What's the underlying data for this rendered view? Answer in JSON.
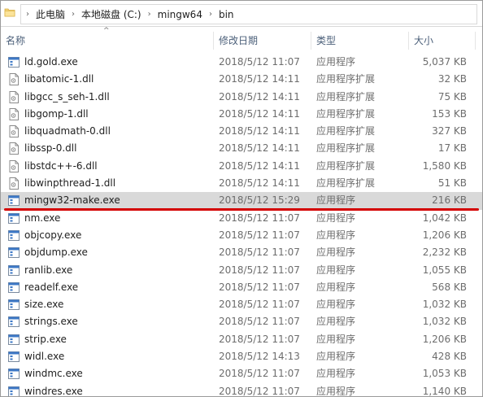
{
  "breadcrumb": {
    "items": [
      "此电脑",
      "本地磁盘 (C:)",
      "mingw64",
      "bin"
    ],
    "separator": "›"
  },
  "columns": {
    "name": "名称",
    "date": "修改日期",
    "type": "类型",
    "size": "大小"
  },
  "files": [
    {
      "name": "ld.gold.exe",
      "date": "2018/5/12 11:07",
      "type": "应用程序",
      "size": "5,037 KB",
      "icon": "exe-icon"
    },
    {
      "name": "libatomic-1.dll",
      "date": "2018/5/12 14:11",
      "type": "应用程序扩展",
      "size": "32 KB",
      "icon": "dll-icon"
    },
    {
      "name": "libgcc_s_seh-1.dll",
      "date": "2018/5/12 14:11",
      "type": "应用程序扩展",
      "size": "75 KB",
      "icon": "dll-icon"
    },
    {
      "name": "libgomp-1.dll",
      "date": "2018/5/12 14:11",
      "type": "应用程序扩展",
      "size": "153 KB",
      "icon": "dll-icon"
    },
    {
      "name": "libquadmath-0.dll",
      "date": "2018/5/12 14:11",
      "type": "应用程序扩展",
      "size": "327 KB",
      "icon": "dll-icon"
    },
    {
      "name": "libssp-0.dll",
      "date": "2018/5/12 14:11",
      "type": "应用程序扩展",
      "size": "17 KB",
      "icon": "dll-icon"
    },
    {
      "name": "libstdc++-6.dll",
      "date": "2018/5/12 14:11",
      "type": "应用程序扩展",
      "size": "1,580 KB",
      "icon": "dll-icon"
    },
    {
      "name": "libwinpthread-1.dll",
      "date": "2018/5/12 14:11",
      "type": "应用程序扩展",
      "size": "51 KB",
      "icon": "dll-icon"
    },
    {
      "name": "mingw32-make.exe",
      "date": "2018/5/12 15:29",
      "type": "应用程序",
      "size": "216 KB",
      "icon": "exe-icon",
      "selected": true
    },
    {
      "name": "nm.exe",
      "date": "2018/5/12 11:07",
      "type": "应用程序",
      "size": "1,042 KB",
      "icon": "exe-icon"
    },
    {
      "name": "objcopy.exe",
      "date": "2018/5/12 11:07",
      "type": "应用程序",
      "size": "1,206 KB",
      "icon": "exe-icon"
    },
    {
      "name": "objdump.exe",
      "date": "2018/5/12 11:07",
      "type": "应用程序",
      "size": "2,232 KB",
      "icon": "exe-icon"
    },
    {
      "name": "ranlib.exe",
      "date": "2018/5/12 11:07",
      "type": "应用程序",
      "size": "1,055 KB",
      "icon": "exe-icon"
    },
    {
      "name": "readelf.exe",
      "date": "2018/5/12 11:07",
      "type": "应用程序",
      "size": "568 KB",
      "icon": "exe-icon"
    },
    {
      "name": "size.exe",
      "date": "2018/5/12 11:07",
      "type": "应用程序",
      "size": "1,032 KB",
      "icon": "exe-icon"
    },
    {
      "name": "strings.exe",
      "date": "2018/5/12 11:07",
      "type": "应用程序",
      "size": "1,032 KB",
      "icon": "exe-icon"
    },
    {
      "name": "strip.exe",
      "date": "2018/5/12 11:07",
      "type": "应用程序",
      "size": "1,206 KB",
      "icon": "exe-icon"
    },
    {
      "name": "widl.exe",
      "date": "2018/5/12 14:13",
      "type": "应用程序",
      "size": "428 KB",
      "icon": "exe-icon"
    },
    {
      "name": "windmc.exe",
      "date": "2018/5/12 11:07",
      "type": "应用程序",
      "size": "1,053 KB",
      "icon": "exe-icon"
    },
    {
      "name": "windres.exe",
      "date": "2018/5/12 11:07",
      "type": "应用程序",
      "size": "1,140 KB",
      "icon": "exe-icon"
    }
  ],
  "colors": {
    "header_text": "#4c607a",
    "selection": "#d9d9d9",
    "annotation_underline": "#d40000"
  }
}
